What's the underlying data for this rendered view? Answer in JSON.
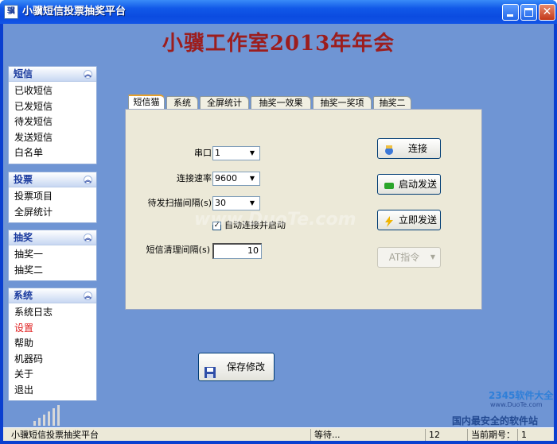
{
  "window": {
    "title": "小骥短信投票抽奖平台",
    "icon_text": "骥"
  },
  "heading": "小骥工作室2013年年会",
  "sidebar": {
    "groups": [
      {
        "title": "短信",
        "items": [
          "已收短信",
          "已发短信",
          "待发短信",
          "发送短信",
          "白名单"
        ]
      },
      {
        "title": "投票",
        "items": [
          "投票项目",
          "全屏统计"
        ]
      },
      {
        "title": "抽奖",
        "items": [
          "抽奖一",
          "抽奖二"
        ]
      },
      {
        "title": "系统",
        "items": [
          "系统日志",
          "设置",
          "帮助",
          "机器码",
          "关于",
          "退出"
        ],
        "active_item": "设置"
      }
    ]
  },
  "tabs": [
    "短信猫",
    "系统",
    "全屏统计",
    "抽奖一效果",
    "抽奖一奖项",
    "抽奖二"
  ],
  "active_tab": "短信猫",
  "form": {
    "port_label": "串口",
    "port_value": "1",
    "baud_label": "连接速率",
    "baud_value": "9600",
    "scan_label": "待发扫描间隔(s)",
    "scan_value": "30",
    "auto_connect_label": "自动连接并启动",
    "auto_connect_checked": true,
    "clean_label": "短信清理间隔(s)",
    "clean_value": "10"
  },
  "buttons": {
    "connect": "连接",
    "start_send": "启动发送",
    "send_now": "立即发送",
    "at_command": "AT指令",
    "save": "保存修改"
  },
  "statusbar": {
    "app_name": "小骥短信投票抽奖平台",
    "status": "等待...",
    "count": "12",
    "period_label": "当前期号：",
    "period_value": "1"
  },
  "watermark": {
    "center": "www.DuoTe.com",
    "brand": "2345软件大全",
    "url": "www.DuoTe.com",
    "slogan": "国内最安全的软件站"
  },
  "colors": {
    "heading": "#9c1d1d",
    "active_nav": "#e02020",
    "nav_title": "#1a3a9e",
    "client_bg": "#6f95d4"
  }
}
